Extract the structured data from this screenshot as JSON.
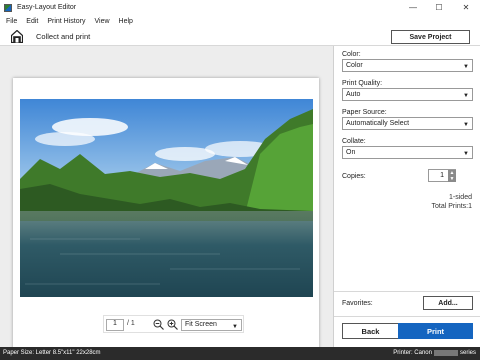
{
  "window": {
    "title": "Easy-Layout Editor",
    "minimize": "—",
    "maximize": "☐",
    "close": "✕"
  },
  "menu": [
    "File",
    "Edit",
    "Print History",
    "View",
    "Help"
  ],
  "header": {
    "title": "Collect and print",
    "save_label": "Save Project"
  },
  "preview": {
    "page_current": "1",
    "page_total": "/ 1",
    "fit_option": "Fit Screen"
  },
  "settings": {
    "color": {
      "label": "Color:",
      "value": "Color"
    },
    "quality": {
      "label": "Print Quality:",
      "value": "Auto"
    },
    "source": {
      "label": "Paper Source:",
      "value": "Automatically Select"
    },
    "collate": {
      "label": "Collate:",
      "value": "On"
    },
    "copies": {
      "label": "Copies:",
      "value": "1"
    },
    "sided": "1-sided",
    "total_prints": "Total Prints:1",
    "favorites_label": "Favorites:",
    "add_label": "Add...",
    "back_label": "Back",
    "print_label": "Print"
  },
  "status": {
    "paper_size": "Paper Size: Letter 8.5\"x11\" 22x28cm",
    "printer_prefix": "Printer: Canon",
    "printer_suffix": "series"
  },
  "colors": {
    "accent": "#1565c0",
    "statusbar": "#2b2b2b",
    "preview_bg": "#ededed"
  }
}
